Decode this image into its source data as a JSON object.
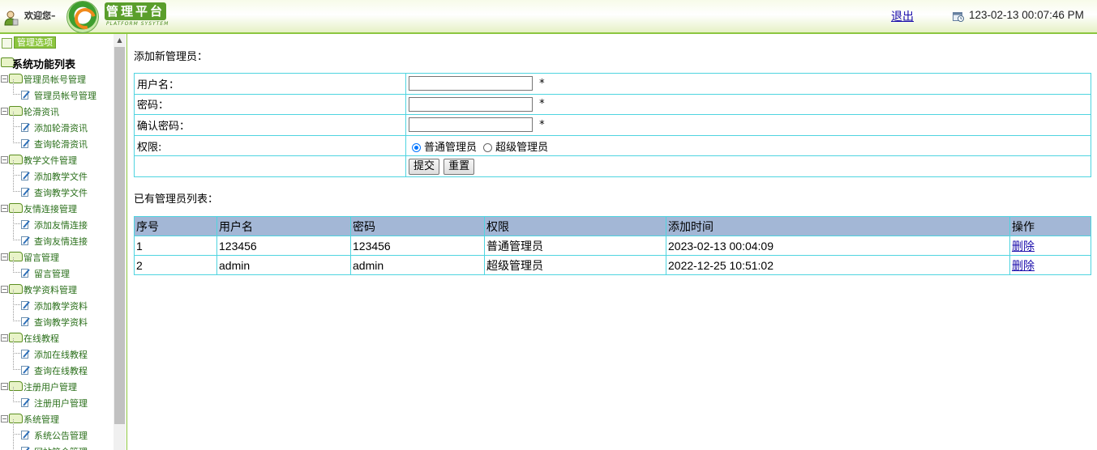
{
  "header": {
    "welcome": "欢迎您–",
    "logo_text": "管理平台",
    "logo_sub": "PLATFORM SYSYTEM",
    "logout_label": "退出",
    "datetime": "123-02-13 00:07:46 PM"
  },
  "sidebar": {
    "tab_label": "管理选项",
    "root_label": "系统功能列表",
    "categories": [
      {
        "label": "管理员帐号管理",
        "items": [
          "管理员帐号管理"
        ]
      },
      {
        "label": "轮滑资讯",
        "items": [
          "添加轮滑资讯",
          "查询轮滑资讯"
        ]
      },
      {
        "label": "教学文件管理",
        "items": [
          "添加教学文件",
          "查询教学文件"
        ]
      },
      {
        "label": "友情连接管理",
        "items": [
          "添加友情连接",
          "查询友情连接"
        ]
      },
      {
        "label": "留言管理",
        "items": [
          "留言管理"
        ]
      },
      {
        "label": "教学资料管理",
        "items": [
          "添加教学资料",
          "查询教学资料"
        ]
      },
      {
        "label": "在线教程",
        "items": [
          "添加在线教程",
          "查询在线教程"
        ]
      },
      {
        "label": "注册用户管理",
        "items": [
          "注册用户管理"
        ]
      },
      {
        "label": "系统管理",
        "items": [
          "系统公告管理",
          "网站简介管理"
        ]
      }
    ]
  },
  "form": {
    "title": "添加新管理员：",
    "username_label": "用户名：",
    "password_label": "密码：",
    "confirm_label": "确认密码：",
    "role_label": "权限:",
    "required_mark": "*",
    "role_normal": "普通管理员",
    "role_super": "超级管理员",
    "selected_role": "普通管理员",
    "submit_label": "提交",
    "reset_label": "重置",
    "username_value": "",
    "password_value": "",
    "confirm_value": ""
  },
  "list": {
    "title": "已有管理员列表：",
    "columns": [
      "序号",
      "用户名",
      "密码",
      "权限",
      "添加时间",
      "操作"
    ],
    "rows": [
      [
        "1",
        "123456",
        "123456",
        "普通管理员",
        "2023-02-13 00:04:09",
        "删除"
      ],
      [
        "2",
        "admin",
        "admin",
        "超级管理员",
        "2022-12-25 10:51:02",
        "删除"
      ]
    ]
  },
  "colors": {
    "accent_green": "#8cc63f",
    "table_border": "#4fd4e0",
    "table_header_bg": "#a3b7d6",
    "link": "#1a0dab"
  },
  "icons": [
    "user-icon",
    "logo-emblem-icon",
    "clock-icon",
    "calendar-icon",
    "folder-icon",
    "document-edit-icon",
    "scroll-up-arrow-icon"
  ]
}
